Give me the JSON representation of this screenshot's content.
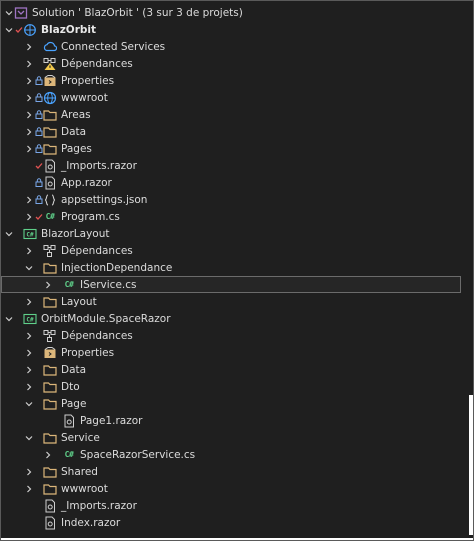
{
  "solution": {
    "label": "Solution ' BlazOrbit ' (3 sur 3 de projets)"
  },
  "projects": {
    "blazorbit": {
      "label": "BlazOrbit",
      "items": {
        "connected": "Connected Services",
        "dependances": "Dépendances",
        "properties": "Properties",
        "wwwroot": "wwwroot",
        "areas": "Areas",
        "data": "Data",
        "pages": "Pages",
        "imports": "_Imports.razor",
        "app": "App.razor",
        "appsettings": "appsettings.json",
        "program": "Program.cs"
      }
    },
    "blazorlayout": {
      "label": "BlazorLayout",
      "items": {
        "dependances": "Dépendances",
        "injection": "InjectionDependance",
        "iservice": "IService.cs",
        "layout": "Layout"
      }
    },
    "spacerazor": {
      "label": "OrbitModule.SpaceRazor",
      "items": {
        "dependances": "Dépendances",
        "properties": "Properties",
        "data": "Data",
        "dto": "Dto",
        "page": "Page",
        "page1": "Page1.razor",
        "service": "Service",
        "spaceservice": "SpaceRazorService.cs",
        "shared": "Shared",
        "wwwroot": "wwwroot",
        "imports": "_Imports.razor",
        "index": "Index.razor"
      }
    }
  },
  "glyphs": {
    "csharp": "C#"
  },
  "colors": {
    "background": "#1f1f1f",
    "folder": "#dcb67a",
    "vs_purple": "#a074c4",
    "check_red": "#e05252",
    "csharp_green": "#5fd08a",
    "lock_blue": "#7aa7e8",
    "globe_blue": "#4aa3ff"
  }
}
